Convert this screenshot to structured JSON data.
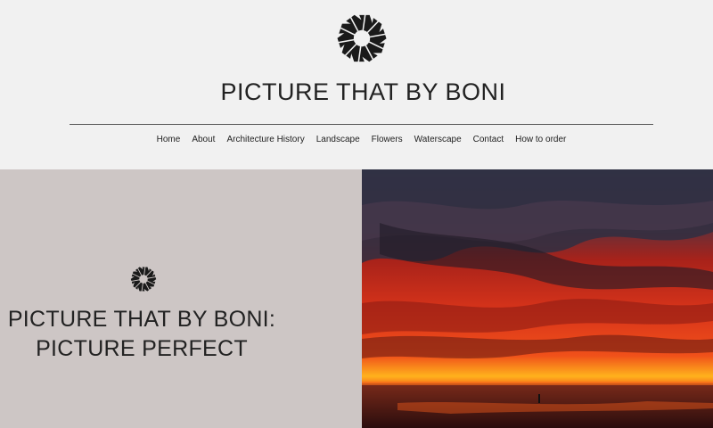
{
  "site": {
    "title": "PICTURE THAT BY BONI"
  },
  "nav": {
    "items": [
      {
        "label": "Home"
      },
      {
        "label": "About"
      },
      {
        "label": "Architecture History"
      },
      {
        "label": "Landscape"
      },
      {
        "label": "Flowers"
      },
      {
        "label": "Waterscape"
      },
      {
        "label": "Contact"
      },
      {
        "label": "How to order"
      }
    ]
  },
  "hero": {
    "title_line1": "PICTURE THAT BY BONI:",
    "title_line2": "PICTURE PERFECT",
    "background_color": "#cdc6c5"
  },
  "icons": {
    "logo": "aperture-logo-icon"
  }
}
